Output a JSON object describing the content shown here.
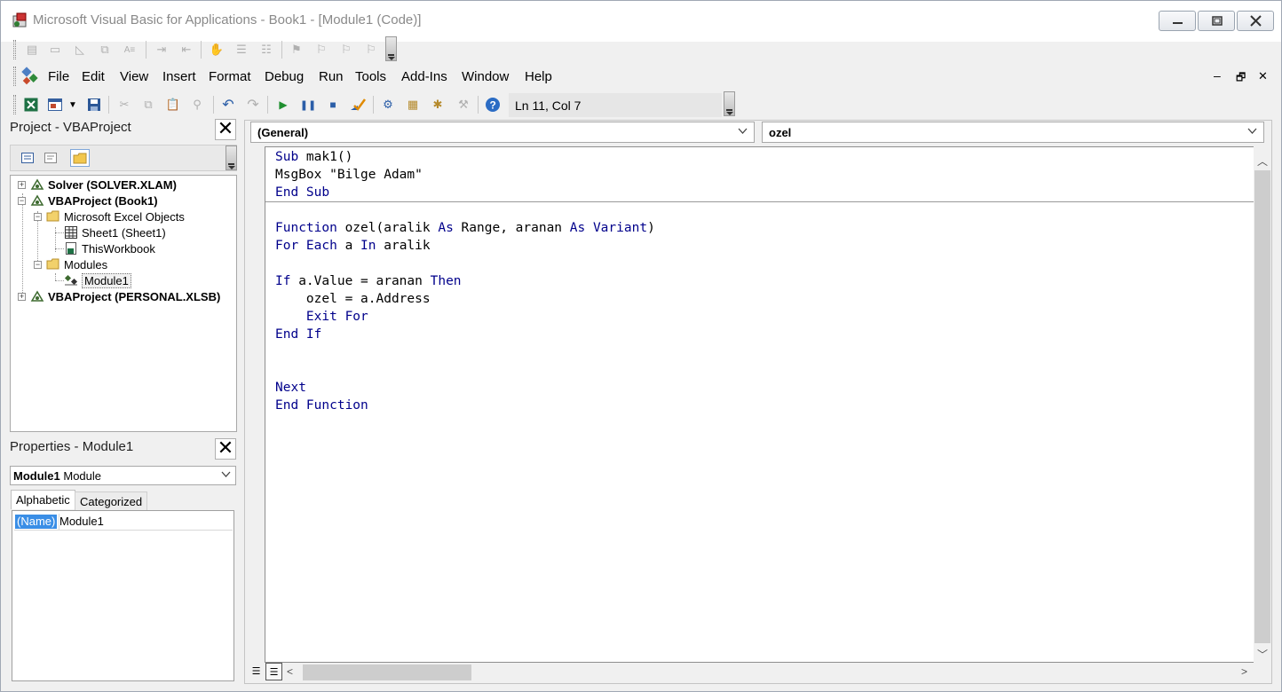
{
  "window": {
    "title": "Microsoft Visual Basic for Applications - Book1 - [Module1 (Code)]"
  },
  "menu": {
    "items": [
      "File",
      "Edit",
      "View",
      "Insert",
      "Format",
      "Debug",
      "Run",
      "Tools",
      "Add-Ins",
      "Window",
      "Help"
    ]
  },
  "toolbar": {
    "cursor_position": "Ln 11, Col 7"
  },
  "project": {
    "title": "Project - VBAProject",
    "tree": [
      {
        "label": "Solver (SOLVER.XLAM)",
        "bold": true
      },
      {
        "label": "VBAProject (Book1)",
        "bold": true
      },
      {
        "label": "Microsoft Excel Objects",
        "bold": false
      },
      {
        "label": "Sheet1 (Sheet1)",
        "bold": false
      },
      {
        "label": "ThisWorkbook",
        "bold": false
      },
      {
        "label": "Modules",
        "bold": false
      },
      {
        "label": "Module1",
        "bold": false
      },
      {
        "label": "VBAProject (PERSONAL.XLSB)",
        "bold": true
      }
    ]
  },
  "properties": {
    "title": "Properties - Module1",
    "object_name": "Module1",
    "object_type": "Module",
    "tabs": [
      "Alphabetic",
      "Categorized"
    ],
    "rows": [
      {
        "name": "(Name)",
        "value": "Module1"
      }
    ]
  },
  "code": {
    "object_combo": "(General)",
    "procedure_combo": "ozel",
    "lines": [
      [
        {
          "t": "kw",
          "v": "Sub"
        },
        {
          "t": "tx",
          "v": " mak1()"
        }
      ],
      [
        {
          "t": "tx",
          "v": "MsgBox \"Bilge Adam\""
        }
      ],
      [
        {
          "t": "kw",
          "v": "End Sub"
        }
      ],
      [],
      [
        {
          "t": "kw",
          "v": "Function"
        },
        {
          "t": "tx",
          "v": " ozel(aralik "
        },
        {
          "t": "kw",
          "v": "As"
        },
        {
          "t": "tx",
          "v": " Range, aranan "
        },
        {
          "t": "kw",
          "v": "As Variant"
        },
        {
          "t": "tx",
          "v": ")"
        }
      ],
      [
        {
          "t": "kw",
          "v": "For Each"
        },
        {
          "t": "tx",
          "v": " a "
        },
        {
          "t": "kw",
          "v": "In"
        },
        {
          "t": "tx",
          "v": " aralik"
        }
      ],
      [],
      [
        {
          "t": "kw",
          "v": "If"
        },
        {
          "t": "tx",
          "v": " a.Value = aranan "
        },
        {
          "t": "kw",
          "v": "Then"
        }
      ],
      [
        {
          "t": "tx",
          "v": "    ozel = a.Address"
        }
      ],
      [
        {
          "t": "kw",
          "v": "    Exit For"
        }
      ],
      [
        {
          "t": "kw",
          "v": "End If"
        }
      ],
      [],
      [],
      [
        {
          "t": "kw",
          "v": "Next"
        }
      ],
      [
        {
          "t": "kw",
          "v": "End Function"
        }
      ]
    ]
  },
  "colors": {
    "keyword": "#00008b",
    "selection": "#3a8ee6"
  }
}
